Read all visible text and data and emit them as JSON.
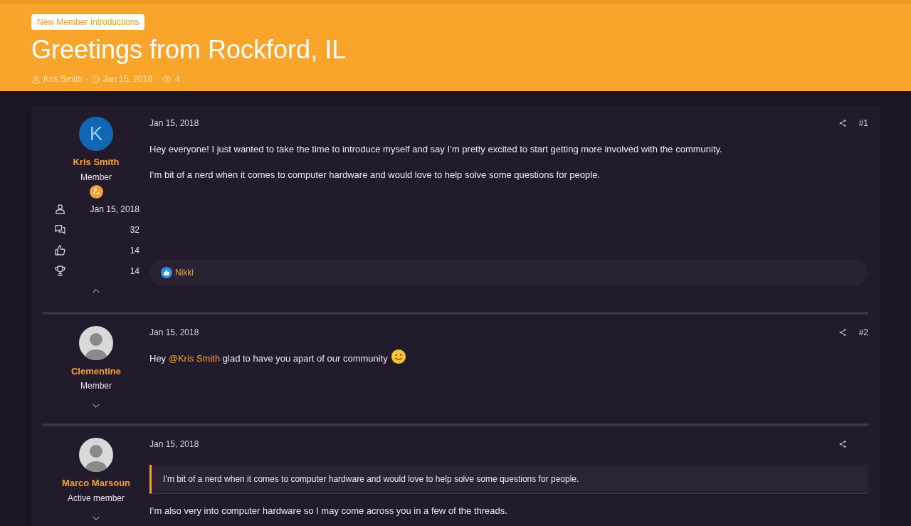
{
  "thread": {
    "forum_tag": "New Member Introductions",
    "title": "Greetings from Rockford, IL",
    "author": "Kris Smith",
    "date": "Jan 15, 2018",
    "views": "4",
    "separator": "·"
  },
  "posts": [
    {
      "user": {
        "name": "Kris Smith",
        "role": "Member",
        "avatar": {
          "kind": "letter",
          "letter": "K"
        },
        "has_badge": true,
        "expanded": true,
        "stats": [
          {
            "kind": "joined",
            "value": "Jan 15, 2018"
          },
          {
            "kind": "messages",
            "value": "32"
          },
          {
            "kind": "reactions",
            "value": "14"
          },
          {
            "kind": "trophies",
            "value": "14"
          }
        ]
      },
      "date": "Jan 15, 2018",
      "number": "#1",
      "body": [
        {
          "kind": "paragraph",
          "segments": [
            {
              "kind": "text",
              "text": "Hey everyone! I just wanted to take the time to introduce myself and say I’m pretty excited to start getting more involved with the community."
            }
          ]
        },
        {
          "kind": "paragraph",
          "segments": [
            {
              "kind": "text",
              "text": "I’m bit of a nerd when it comes to computer hardware and would love to help solve some questions for people."
            }
          ]
        }
      ],
      "reactions": [
        "Nikki"
      ]
    },
    {
      "user": {
        "name": "Clementine",
        "role": "Member",
        "avatar": {
          "kind": "photo"
        },
        "expanded": false
      },
      "date": "Jan 15, 2018",
      "number": "#2",
      "body": [
        {
          "kind": "paragraph",
          "segments": [
            {
              "kind": "text",
              "text": "Hey "
            },
            {
              "kind": "mention",
              "text": "@Kris Smith"
            },
            {
              "kind": "text",
              "text": " glad to have you apart of our community"
            },
            {
              "kind": "smiley"
            }
          ]
        }
      ]
    },
    {
      "user": {
        "name": "Marco Marsoun",
        "role": "Active member",
        "avatar": {
          "kind": "photo"
        },
        "expanded": false
      },
      "date": "Jan 15, 2018",
      "body": [
        {
          "kind": "quote",
          "text": "I’m bit of a nerd when it comes to computer hardware and would love to help solve some questions for people."
        },
        {
          "kind": "paragraph",
          "segments": [
            {
              "kind": "text",
              "text": "I’m also very into computer hardware so I may come across you in a few of the threads."
            }
          ]
        }
      ]
    }
  ]
}
